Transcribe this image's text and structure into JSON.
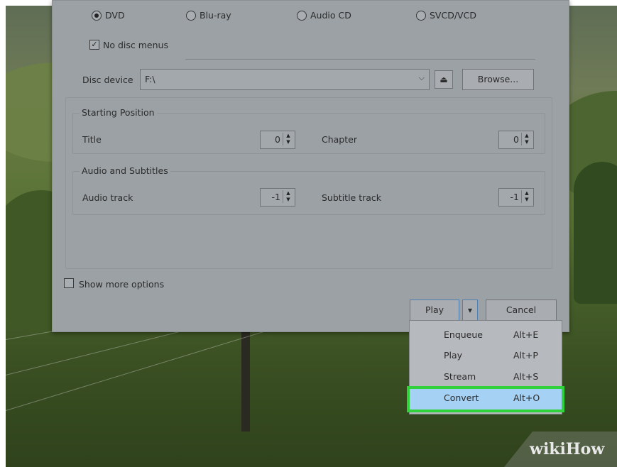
{
  "disc_types": [
    {
      "label": "DVD",
      "checked": true
    },
    {
      "label": "Blu-ray",
      "checked": false
    },
    {
      "label": "Audio CD",
      "checked": false
    },
    {
      "label": "SVCD/VCD",
      "checked": false
    }
  ],
  "no_disc_menus": {
    "label": "No disc menus",
    "check_glyph": "✓"
  },
  "disc_device": {
    "label": "Disc device",
    "value": "F:\\",
    "dropdown_glyph": "⌵",
    "eject_glyph": "⏏",
    "browse_label": "Browse..."
  },
  "starting_position": {
    "title": "Starting Position",
    "title_label": "Title",
    "title_value": "0",
    "chapter_label": "Chapter",
    "chapter_value": "0"
  },
  "audio_subtitles": {
    "title": "Audio and Subtitles",
    "audio_label": "Audio track",
    "audio_value": "-1",
    "subtitle_label": "Subtitle track",
    "subtitle_value": "-1"
  },
  "show_more_options": "Show more options",
  "buttons": {
    "play": "Play",
    "play_arrow": "▾",
    "cancel": "Cancel"
  },
  "play_menu": [
    {
      "label": "Enqueue",
      "shortcut": "Alt+E"
    },
    {
      "label": "Play",
      "shortcut": "Alt+P"
    },
    {
      "label": "Stream",
      "shortcut": "Alt+S"
    },
    {
      "label": "Convert",
      "shortcut": "Alt+O",
      "highlighted": true
    }
  ],
  "spin_glyphs": {
    "up": "▲",
    "down": "▼"
  },
  "watermark": "wikiHow",
  "colors": {
    "highlight": "#31d13c",
    "selected_item": "#a5d1f5"
  }
}
